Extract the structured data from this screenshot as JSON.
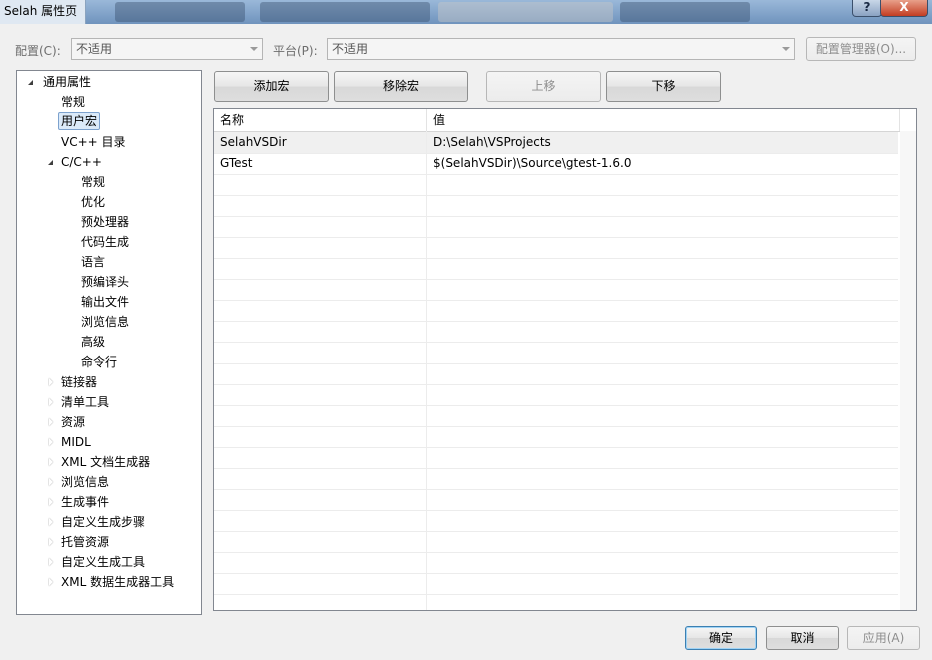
{
  "window": {
    "title": "Selah 属性页",
    "help_label": "?",
    "close_label": "X"
  },
  "config_bar": {
    "config_label": "配置(C):",
    "config_value": "不适用",
    "platform_label": "平台(P):",
    "platform_value": "不适用",
    "config_manager_label": "配置管理器(O)..."
  },
  "toolbar": {
    "add_macro_label": "添加宏",
    "remove_macro_label": "移除宏",
    "move_up_label": "上移",
    "move_down_label": "下移"
  },
  "tree": {
    "root": "通用属性",
    "items": [
      "常规",
      "用户宏",
      "VC++ 目录",
      "C/C++",
      "常规",
      "优化",
      "预处理器",
      "代码生成",
      "语言",
      "预编译头",
      "输出文件",
      "浏览信息",
      "高级",
      "命令行",
      "链接器",
      "清单工具",
      "资源",
      "MIDL",
      "XML 文档生成器",
      "浏览信息",
      "生成事件",
      "自定义生成步骤",
      "托管资源",
      "自定义生成工具",
      "XML 数据生成器工具"
    ],
    "selected": "用户宏"
  },
  "grid": {
    "columns": [
      "名称",
      "值"
    ],
    "rows": [
      [
        "SelahVSDir",
        "D:\\Selah\\VSProjects"
      ],
      [
        "GTest",
        "$(SelahVSDir)\\Source\\gtest-1.6.0"
      ]
    ]
  },
  "footer": {
    "ok_label": "确定",
    "cancel_label": "取消",
    "apply_label": "应用(A)"
  }
}
